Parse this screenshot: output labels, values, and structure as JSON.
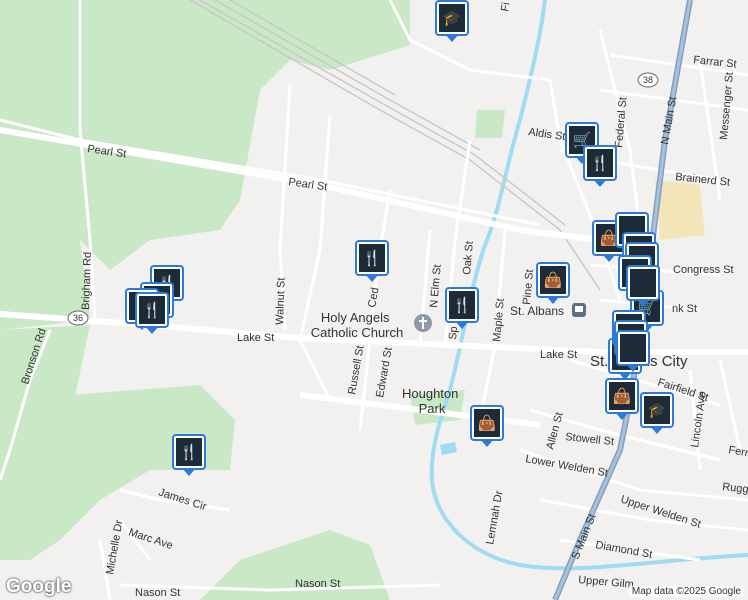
{
  "map": {
    "attribution": "Map data ©2025 Google",
    "logo": "Google",
    "place_labels": {
      "church": "Holy Angels\nCatholic Church",
      "park": "Houghton\nPark",
      "city": "St. Albans City",
      "station": "St. Albans"
    },
    "street_labels": {
      "pearl_w": "Pearl St",
      "pearl_e": "Pearl St",
      "lake_w": "Lake St",
      "lake_e": "Lake St",
      "walnut": "Walnut St",
      "russell": "Russell St",
      "edward": "Edward St",
      "n_elm": "N Elm St",
      "oak": "Oak St",
      "maple": "Maple St",
      "pine": "Pine St",
      "brigham": "Brigham Rd",
      "bronson": "Bronson Rd",
      "aldis": "Aldis St",
      "farrar": "Farrar St",
      "federal": "Federal St",
      "n_main": "N Main St",
      "messenger": "Messenger St",
      "brainerd": "Brainerd St",
      "congress": "Congress St",
      "fairfield": "Fairfield St",
      "stowell": "Stowell St",
      "lower_welden": "Lower Welden St",
      "upper_welden": "Upper Welden St",
      "diamond": "Diamond St",
      "upper_gilm": "Upper Gilm",
      "s_main": "S Main St",
      "allen": "Allen St",
      "lincoln": "Lincoln Ave",
      "lemnah": "Lemnah Dr",
      "james": "James Cir",
      "marc": "Marc Ave",
      "michelle": "Michelle Dr",
      "nason_w": "Nason St",
      "nason_c": "Nason St",
      "ced": "Ced",
      "sp": "Sp",
      "fi": "Fi",
      "rugg": "Rugg",
      "ferr": "Ferr",
      "nk": "nk St",
      "rt36": "36",
      "rt38": "38"
    }
  },
  "markers": [
    {
      "type": "education",
      "icon_name": "graduation-cap-icon"
    },
    {
      "type": "restaurant",
      "icon_name": "fork-knife-icon"
    },
    {
      "type": "restaurant",
      "icon_name": "fork-knife-icon"
    },
    {
      "type": "restaurant",
      "icon_name": "fork-knife-icon"
    },
    {
      "type": "restaurant",
      "icon_name": "fork-knife-icon"
    },
    {
      "type": "restaurant",
      "icon_name": "fork-knife-icon"
    },
    {
      "type": "restaurant",
      "icon_name": "fork-knife-icon"
    },
    {
      "type": "grocery",
      "icon_name": "shopping-cart-icon"
    },
    {
      "type": "restaurant",
      "icon_name": "fork-knife-icon"
    },
    {
      "type": "shopping",
      "icon_name": "shopping-bag-icon"
    },
    {
      "type": "shopping",
      "icon_name": "shopping-bag-icon"
    },
    {
      "type": "shopping",
      "icon_name": "shopping-bag-icon"
    },
    {
      "type": "grocery",
      "icon_name": "shopping-cart-icon"
    },
    {
      "type": "shopping",
      "icon_name": "shopping-bag-icon"
    },
    {
      "type": "shopping",
      "icon_name": "shopping-bag-icon"
    },
    {
      "type": "education",
      "icon_name": "graduation-cap-icon"
    },
    {
      "type": "restaurant",
      "icon_name": "fork-knife-icon"
    }
  ],
  "colors": {
    "park": "#c9e8c6",
    "water": "#9fdcf2",
    "road": "#ffffff",
    "highway": "#7fa0c0",
    "background": "#f2f1ef",
    "marker_border": "#2a7ad6"
  }
}
